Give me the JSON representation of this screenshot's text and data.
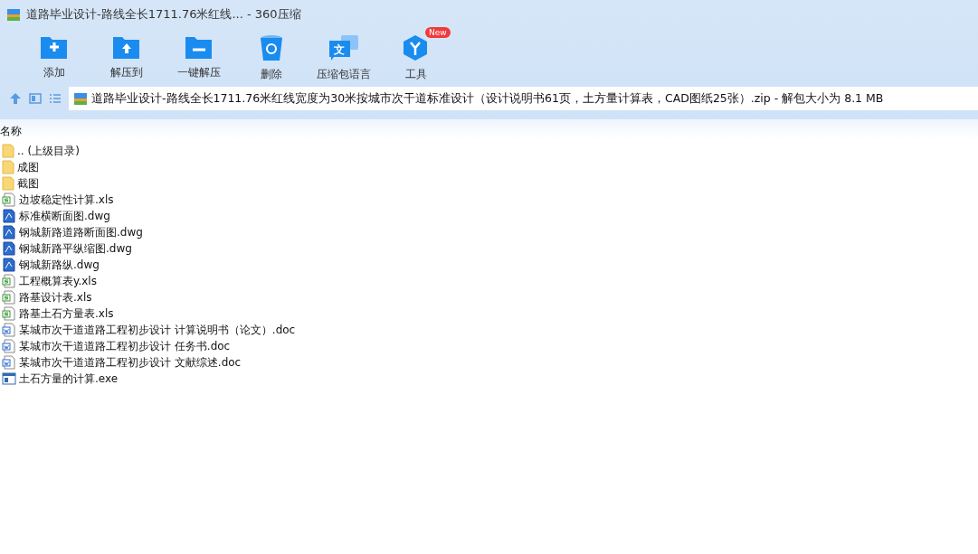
{
  "window": {
    "title": "道路毕业设计-路线全长1711.76米红线... - 360压缩"
  },
  "toolbar": [
    {
      "kind": "add",
      "label": "添加"
    },
    {
      "kind": "extract",
      "label": "解压到"
    },
    {
      "kind": "oneclick",
      "label": "一键解压"
    },
    {
      "kind": "delete",
      "label": "删除"
    },
    {
      "kind": "language",
      "label": "压缩包语言",
      "glyph": "文"
    },
    {
      "kind": "tools",
      "label": "工具",
      "badge": "New"
    }
  ],
  "address_bar": {
    "path": "道路毕业设计-路线全长1711.76米红线宽度为30米按城市次干道标准设计（设计说明书61页，土方量计算表，CAD图纸25张）.zip - 解包大小为 8.1 MB"
  },
  "table": {
    "columns": [
      "名称"
    ],
    "rows": [
      {
        "kind": "folder",
        "name": ".. (上级目录)"
      },
      {
        "kind": "folder",
        "name": "成图"
      },
      {
        "kind": "folder",
        "name": "截图"
      },
      {
        "kind": "xls",
        "name": "边坡稳定性计算.xls"
      },
      {
        "kind": "dwg",
        "name": "标准横断面图.dwg"
      },
      {
        "kind": "dwg",
        "name": "钢城新路道路断面图.dwg"
      },
      {
        "kind": "dwg",
        "name": "钢城新路平纵缩图.dwg"
      },
      {
        "kind": "dwg",
        "name": "钢城新路纵.dwg"
      },
      {
        "kind": "xls",
        "name": "工程概算表y.xls"
      },
      {
        "kind": "xls",
        "name": "路基设计表.xls"
      },
      {
        "kind": "xls",
        "name": "路基土石方量表.xls"
      },
      {
        "kind": "doc",
        "name": "某城市次干道道路工程初步设计 计算说明书（论文）.doc"
      },
      {
        "kind": "doc",
        "name": "某城市次干道道路工程初步设计 任务书.doc"
      },
      {
        "kind": "doc",
        "name": "某城市次干道道路工程初步设计 文献综述.doc"
      },
      {
        "kind": "exe",
        "name": "土石方量的计算.exe"
      }
    ]
  }
}
